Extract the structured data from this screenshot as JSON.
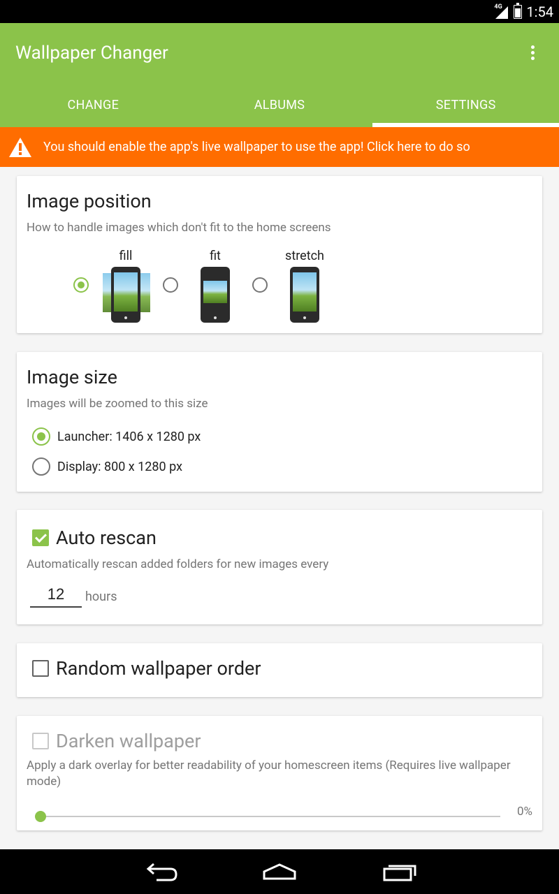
{
  "status_bar": {
    "network": "4G",
    "time": "1:54"
  },
  "app_bar": {
    "title": "Wallpaper Changer",
    "tabs": [
      {
        "label": "CHANGE",
        "active": false
      },
      {
        "label": "ALBUMS",
        "active": false
      },
      {
        "label": "SETTINGS",
        "active": true
      }
    ],
    "colors": {
      "primary": "#8bc34a"
    }
  },
  "banner": {
    "text": "You should enable the app's live wallpaper to use the app! Click here to do so",
    "color": "#ff6d00",
    "icon": "warning-icon"
  },
  "image_position": {
    "title": "Image position",
    "subtitle": "How to handle images which don't fit to the home screens",
    "options": [
      {
        "label": "fill",
        "selected": true
      },
      {
        "label": "fit",
        "selected": false
      },
      {
        "label": "stretch",
        "selected": false
      }
    ]
  },
  "image_size": {
    "title": "Image size",
    "subtitle": "Images will be zoomed to this size",
    "options": [
      {
        "label": "Launcher: 1406 x 1280 px",
        "selected": true
      },
      {
        "label": "Display: 800 x 1280 px",
        "selected": false
      }
    ]
  },
  "auto_rescan": {
    "title": "Auto rescan",
    "checked": true,
    "subtitle": "Automatically rescan added folders for new images every",
    "hours_value": "12",
    "hours_unit": "hours"
  },
  "random_order": {
    "title": "Random wallpaper order",
    "checked": false
  },
  "darken": {
    "title": "Darken wallpaper",
    "checked": false,
    "enabled": false,
    "subtitle": "Apply a dark overlay for better readability of your homescreen items (Requires live wallpaper mode)",
    "value_label": "0%",
    "value": 0
  },
  "nav_bar": {
    "buttons": [
      "back-icon",
      "home-icon",
      "recents-icon"
    ]
  }
}
